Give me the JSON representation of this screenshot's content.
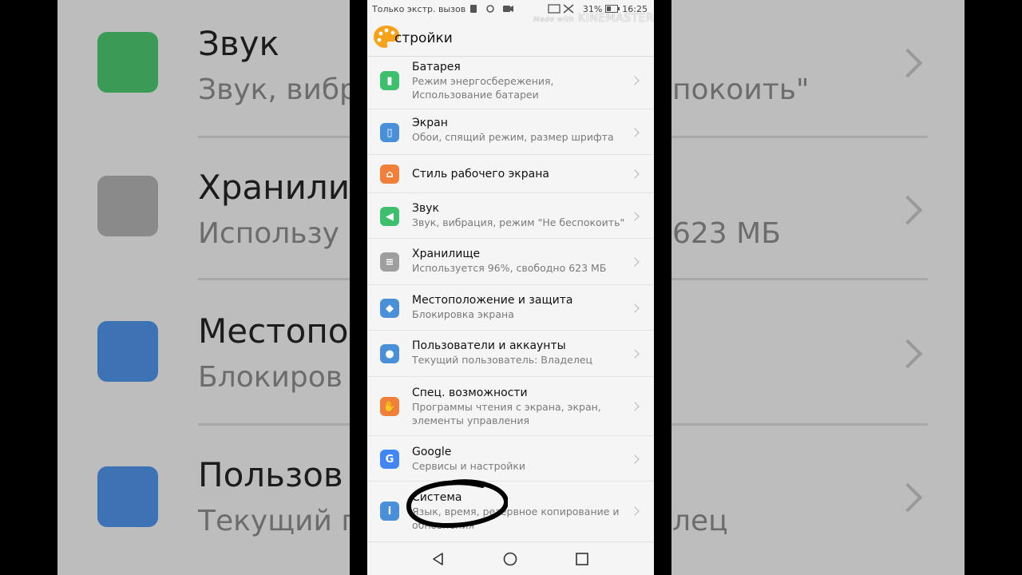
{
  "status_bar": {
    "carrier": "Только экстр. вызов",
    "battery_percent": "31%",
    "time": "16:25"
  },
  "watermark": {
    "prefix": "Made with",
    "brand": "KINEMASTER"
  },
  "header": {
    "title": "Настройки",
    "visible_title": "стройки"
  },
  "items": [
    {
      "title": "Батарея",
      "subtitle": "Режим энергосбережения, Использование батареи",
      "icon": "battery-icon",
      "color": "#3dbf6e"
    },
    {
      "title": "Экран",
      "subtitle": "Обои, спящий режим, размер шрифта",
      "icon": "screen-icon",
      "color": "#4a90d9"
    },
    {
      "title": "Стиль рабочего экрана",
      "subtitle": "",
      "icon": "home-style-icon",
      "color": "#f07f3a"
    },
    {
      "title": "Звук",
      "subtitle": "Звук, вибрация, режим \"Не беспокоить\"",
      "icon": "sound-icon",
      "color": "#3dbf6e"
    },
    {
      "title": "Хранилище",
      "subtitle": "Используется 96%, свободно 623 МБ",
      "icon": "storage-icon",
      "color": "#9e9e9e"
    },
    {
      "title": "Местоположение и защита",
      "subtitle": "Блокировка экрана",
      "icon": "shield-icon",
      "color": "#4a90d9"
    },
    {
      "title": "Пользователи и аккаунты",
      "subtitle": "Текущий пользователь: Владелец",
      "icon": "user-icon",
      "color": "#4a90d9"
    },
    {
      "title": "Спец. возможности",
      "subtitle": "Программы чтения с экрана, экран, элементы управления",
      "icon": "accessibility-hand-icon",
      "color": "#f07f3a"
    },
    {
      "title": "Google",
      "subtitle": "Сервисы и настройки",
      "icon": "google-icon",
      "color": "#4285f4"
    },
    {
      "title": "Система",
      "subtitle": "Язык, время, резервное копирование и обновления",
      "icon": "system-info-icon",
      "color": "#4a90d9"
    }
  ],
  "background": {
    "rows": [
      {
        "title": "Звук",
        "subtitle": "Звук, вибр",
        "right": "покоить\""
      },
      {
        "title": "Хранили",
        "subtitle": "Использу",
        "right": "623 МБ"
      },
      {
        "title": "Местопо",
        "subtitle": "Блокиров",
        "right": ""
      },
      {
        "title": "Пользов",
        "subtitle": "Текущий п",
        "right": "лец"
      }
    ]
  },
  "colors": {
    "accent_blue": "#4a90d9",
    "accent_green": "#3dbf6e",
    "accent_orange": "#f07f3a",
    "screen_bg": "#f5f5f5"
  }
}
